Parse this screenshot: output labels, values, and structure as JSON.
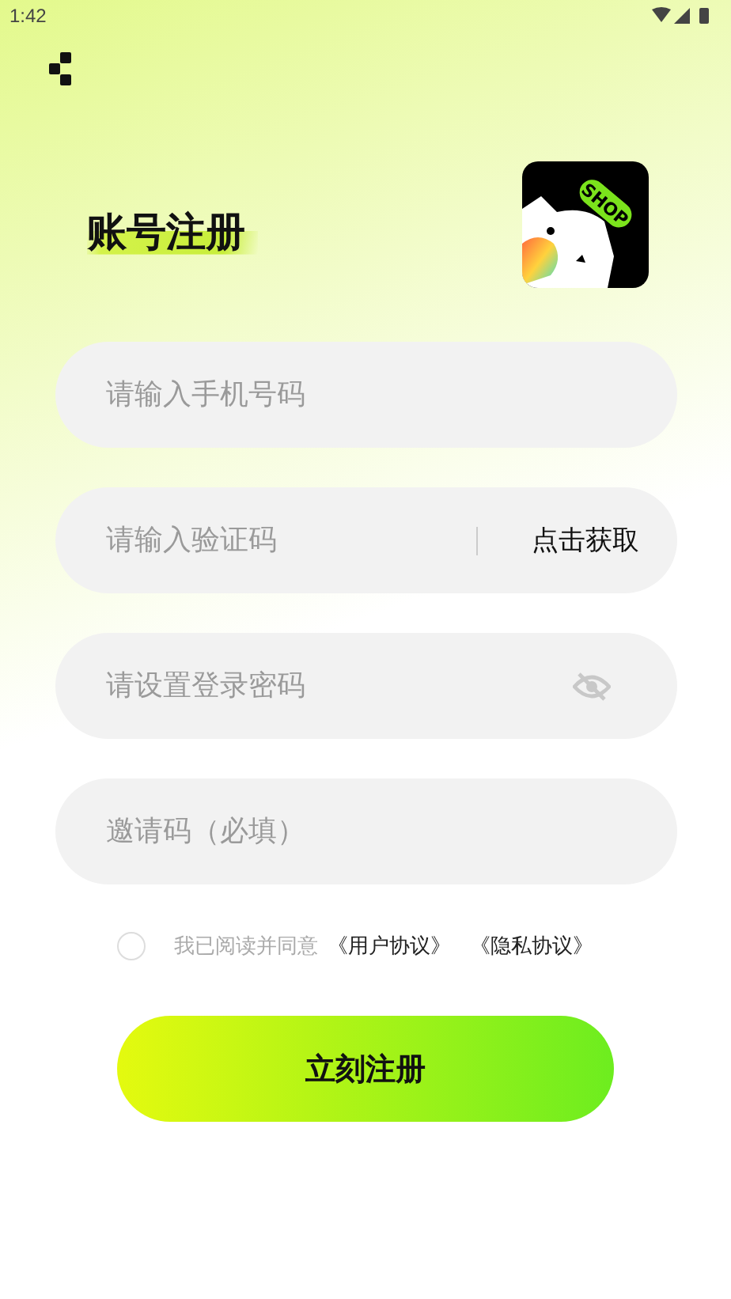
{
  "status_bar": {
    "time": "1:42"
  },
  "header": {
    "title": "账号注册",
    "logo_text": "SHOP"
  },
  "fields": [
    {
      "kind": "text",
      "placeholder": "请输入手机号码"
    },
    {
      "kind": "code",
      "placeholder": "请输入验证码",
      "action": "点击获取"
    },
    {
      "kind": "password",
      "placeholder": "请设置登录密码",
      "visible": false
    },
    {
      "kind": "text",
      "placeholder": "邀请码（必填）"
    }
  ],
  "agreement": {
    "checked": false,
    "text": "我已阅读并同意",
    "links": [
      "《用户协议》",
      "《隐私协议》"
    ]
  },
  "submit": {
    "label": "立刻注册"
  }
}
